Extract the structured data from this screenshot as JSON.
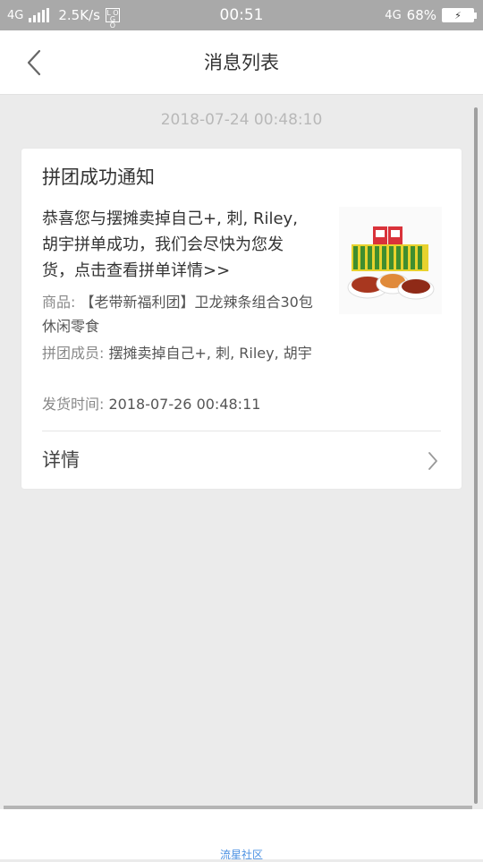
{
  "status_bar": {
    "network": "4G",
    "speed": "2.5K/s",
    "time": "00:51",
    "network_right": "4G",
    "battery": "68%",
    "signal_icon": "signal-bars-icon",
    "battery_icon": "battery-charging-icon"
  },
  "header": {
    "title": "消息列表",
    "back_icon": "chevron-left-icon"
  },
  "message": {
    "timestamp": "2018-07-24 00:48:10",
    "title": "拼团成功通知",
    "body": "恭喜您与摆摊卖掉自己+, 刺, Riley, 胡宇拼单成功，我们会尽快为您发货，点击查看拼单详情>>",
    "goods_label": "商品:",
    "goods_value": "【老带新福利团】卫龙辣条组合30包休闲零食",
    "members_label": "拼团成员:",
    "members_value": "摆摊卖掉自己+, 刺, Riley, 胡宇",
    "ship_label": "发货时间:",
    "ship_value": "2018-07-26 00:48:11",
    "details_label": "详情",
    "product_image": "spicy-snack-product-image"
  },
  "footer": {
    "community_link": "流星社区"
  },
  "colors": {
    "status_bar_bg": "#a9a9a9",
    "page_bg": "#ebebeb",
    "card_bg": "#ffffff",
    "timestamp_text": "#b8b8b8",
    "link_blue": "#4a90e2"
  }
}
